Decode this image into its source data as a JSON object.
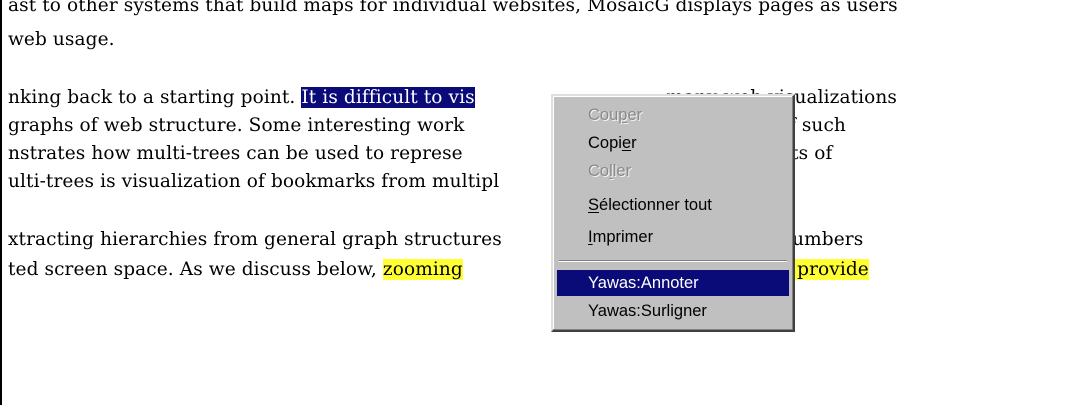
{
  "document": {
    "lines": [
      {
        "id": "l1",
        "segments": [
          {
            "text": "ast to other systems that build maps for individual websites, MosaicG displays pages as users",
            "style": "normal"
          }
        ]
      },
      {
        "id": "l2",
        "segments": [
          {
            "text": "web usage.",
            "style": "normal"
          }
        ]
      },
      {
        "id": "l3",
        "segments": [
          {
            "text": "nking back to a starting point. ",
            "style": "normal"
          },
          {
            "text": "It is difficult to vis",
            "style": "selected"
          },
          {
            "text": "                                ",
            "style": "normal"
          },
          {
            "text": "many web visualizations",
            "style": "normal"
          }
        ]
      },
      {
        "id": "l4",
        "segments": [
          {
            "text": "graphs of web structure. Some interesting work",
            "style": "normal"
          },
          {
            "text": "                           ",
            "style": "normal"
          },
          {
            "text": "e visualizations of such",
            "style": "normal"
          }
        ]
      },
      {
        "id": "l5",
        "segments": [
          {
            "text": "nstrates how multi-trees can be used to represe",
            "style": "normal"
          },
          {
            "text": "                        ",
            "style": "normal"
          },
          {
            "text": "archies sharing parts of",
            "style": "normal"
          }
        ]
      },
      {
        "id": "l6",
        "segments": [
          {
            "text": "ulti-trees is visualization of bookmarks from multipl",
            "style": "normal"
          }
        ]
      },
      {
        "id": "l7",
        "segments": [
          {
            "text": "xtracting hierarchies from general graph structures",
            "style": "normal"
          },
          {
            "text": "                     ",
            "style": "normal"
          },
          {
            "text": "d:splay of large numbers",
            "style": "normal"
          }
        ]
      },
      {
        "id": "l8",
        "segments": [
          {
            "text": "ted screen space. As we discuss below, ",
            "style": "normal"
          },
          {
            "text": "zooming",
            "style": "yellow"
          },
          {
            "text": "                           ",
            "style": "normal"
          },
          {
            "text": "ces [2][3][15][18] provide",
            "style": "yellow"
          }
        ]
      }
    ]
  },
  "context_menu": {
    "items": [
      {
        "id": "cut",
        "label": "Couper",
        "mnemonic_index": 3,
        "disabled": true,
        "active": false
      },
      {
        "id": "copy",
        "label": "Copier",
        "mnemonic_index": 4,
        "disabled": false,
        "active": false
      },
      {
        "id": "paste",
        "label": "Coller",
        "mnemonic_index": 2,
        "disabled": true,
        "active": false
      },
      {
        "id": "select-all",
        "label": "Sélectionner tout",
        "mnemonic_index": 0,
        "disabled": false,
        "active": false
      },
      {
        "id": "print",
        "label": "Imprimer",
        "mnemonic_index": 0,
        "disabled": false,
        "active": false
      },
      {
        "id": "separator"
      },
      {
        "id": "yawas-annotate",
        "label": "Yawas:Annoter",
        "mnemonic_index": -1,
        "disabled": false,
        "active": true
      },
      {
        "id": "yawas-highlight",
        "label": "Yawas:Surligner",
        "mnemonic_index": -1,
        "disabled": false,
        "active": false
      }
    ]
  },
  "colors": {
    "selection": "#0a0a78",
    "highlight_yellow": "#ffff33",
    "menu_face": "#c0c0c0",
    "disabled_text": "#8a8a8a"
  }
}
